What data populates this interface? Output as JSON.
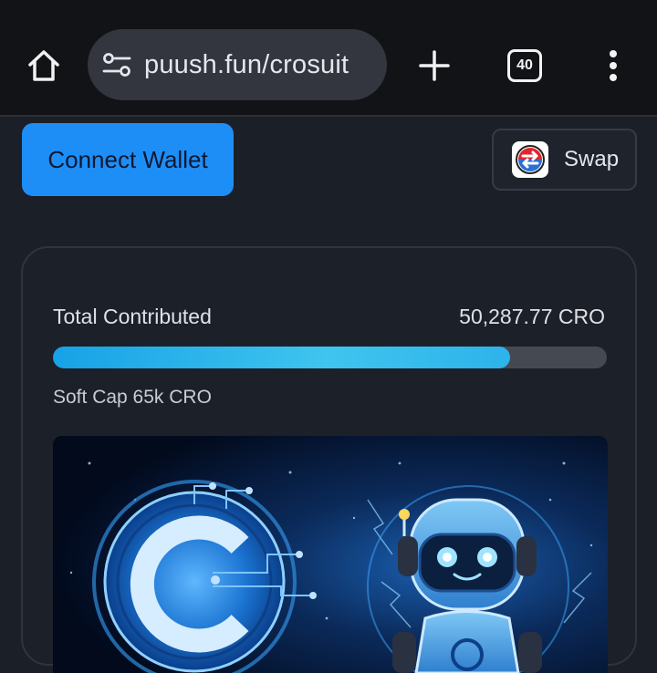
{
  "browser": {
    "url": "puush.fun/crosuit",
    "tab_count": "40",
    "icons": {
      "home": "home-icon",
      "site_settings": "tune-icon",
      "new_tab": "plus-icon",
      "tabs": "tab-switcher-icon",
      "menu": "more-vert-icon"
    }
  },
  "header": {
    "connect_label": "Connect Wallet",
    "swap_label": "Swap"
  },
  "presale": {
    "total_label": "Total Contributed",
    "total_value": "50,287.77 CRO",
    "progress_fraction": 0.826,
    "softcap_text": "Soft Cap 65k CRO"
  },
  "colors": {
    "accent": "#1e8ef7",
    "progress": "#2db3ea",
    "background": "#1b1f27"
  }
}
